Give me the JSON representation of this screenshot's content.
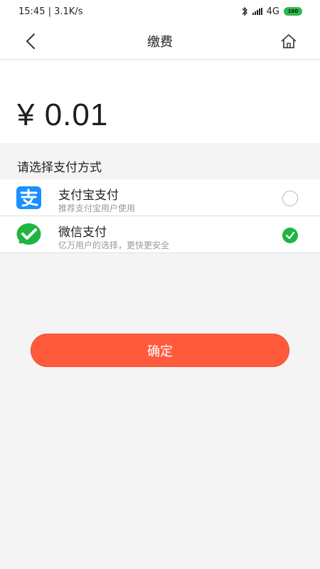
{
  "status_bar": {
    "time_speed": "15:45 | 3.1K/s",
    "network": "4G",
    "battery": "100",
    "icons": [
      "bluetooth-icon",
      "signal-icon",
      "battery-icon"
    ]
  },
  "header": {
    "title": "缴费",
    "back_icon": "back-arrow-icon",
    "home_icon": "home-icon"
  },
  "amount": {
    "value": "¥ 0.01"
  },
  "payment": {
    "section_title": "请选择支付方式",
    "options": [
      {
        "name": "支付宝支付",
        "description": "推荐支付宝用户使用",
        "selected": false,
        "icon": "alipay-icon",
        "color": "#1890ff"
      },
      {
        "name": "微信支付",
        "description": "亿万用户的选择，更快更安全",
        "selected": true,
        "icon": "wechat-pay-icon",
        "color": "#20b540"
      }
    ]
  },
  "actions": {
    "confirm_label": "确定",
    "confirm_color": "#ff5a3c"
  }
}
